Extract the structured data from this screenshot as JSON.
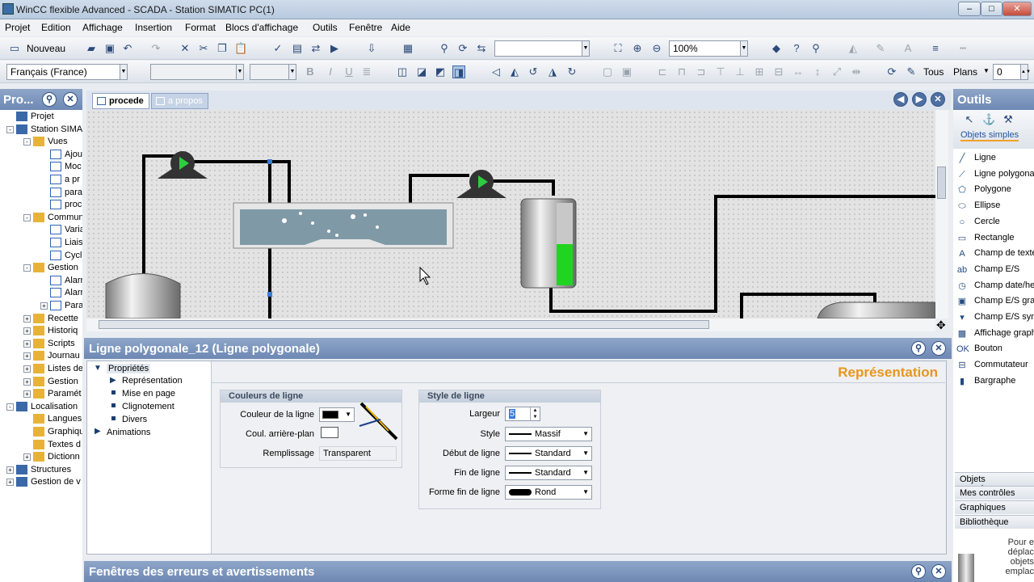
{
  "window": {
    "title": "WinCC flexible Advanced - SCADA - Station SIMATIC PC(1)"
  },
  "menu": [
    "Projet",
    "Edition",
    "Affichage",
    "Insertion",
    "Format",
    "Blocs d'affichage",
    "Outils",
    "Fenêtre",
    "Aide"
  ],
  "toolbar": {
    "new_label": "Nouveau",
    "zoom": "100%",
    "language": "Français (France)",
    "tous": "Tous",
    "plans": "Plans",
    "plans_value": "0"
  },
  "project_panel": {
    "title": "Pro...",
    "tree": [
      {
        "label": "Projet",
        "level": 0,
        "exp": ""
      },
      {
        "label": "Station SIMA",
        "level": 0,
        "exp": "-"
      },
      {
        "label": "Vues",
        "level": 1,
        "exp": "-"
      },
      {
        "label": "Ajou",
        "level": 2,
        "exp": ""
      },
      {
        "label": "Moc",
        "level": 2,
        "exp": ""
      },
      {
        "label": "a pr",
        "level": 2,
        "exp": ""
      },
      {
        "label": "para",
        "level": 2,
        "exp": ""
      },
      {
        "label": "proc",
        "level": 2,
        "exp": ""
      },
      {
        "label": "Commun",
        "level": 1,
        "exp": "-"
      },
      {
        "label": "Varia",
        "level": 2,
        "exp": ""
      },
      {
        "label": "Liais",
        "level": 2,
        "exp": ""
      },
      {
        "label": "Cycl",
        "level": 2,
        "exp": ""
      },
      {
        "label": "Gestion",
        "level": 1,
        "exp": "-"
      },
      {
        "label": "Alarr",
        "level": 2,
        "exp": ""
      },
      {
        "label": "Alarr",
        "level": 2,
        "exp": ""
      },
      {
        "label": "Para",
        "level": 2,
        "exp": "+"
      },
      {
        "label": "Recette",
        "level": 1,
        "exp": "+"
      },
      {
        "label": "Historiq",
        "level": 1,
        "exp": "+"
      },
      {
        "label": "Scripts",
        "level": 1,
        "exp": "+"
      },
      {
        "label": "Journau",
        "level": 1,
        "exp": "+"
      },
      {
        "label": "Listes de",
        "level": 1,
        "exp": "+"
      },
      {
        "label": "Gestion",
        "level": 1,
        "exp": "+"
      },
      {
        "label": "Paramét",
        "level": 1,
        "exp": "+"
      },
      {
        "label": "Localisation",
        "level": 0,
        "exp": "-"
      },
      {
        "label": "Langues",
        "level": 1,
        "exp": ""
      },
      {
        "label": "Graphiqu",
        "level": 1,
        "exp": ""
      },
      {
        "label": "Textes d",
        "level": 1,
        "exp": ""
      },
      {
        "label": "Dictionn",
        "level": 1,
        "exp": "+"
      },
      {
        "label": "Structures",
        "level": 0,
        "exp": "+"
      },
      {
        "label": "Gestion de v",
        "level": 0,
        "exp": "+"
      }
    ]
  },
  "tabs": [
    {
      "label": "procede",
      "active": true
    },
    {
      "label": "a propos",
      "active": false
    }
  ],
  "properties": {
    "header": "Ligne polygonale_12 (Ligne polygonale)",
    "nav": {
      "proprietes": "Propriétés",
      "representation": "Représentation",
      "mise_en_page": "Mise en page",
      "clignotement": "Clignotement",
      "divers": "Divers",
      "animations": "Animations"
    },
    "section_title": "Représentation",
    "line_colors": {
      "title": "Couleurs de ligne",
      "couleur_label": "Couleur de la ligne",
      "couleur_value": "#000000",
      "arriere_label": "Coul. arrière-plan",
      "arriere_value": "#ffffff",
      "remplissage_label": "Remplissage",
      "remplissage_value": "Transparent"
    },
    "line_style": {
      "title": "Style de ligne",
      "largeur_label": "Largeur",
      "largeur_value": "5",
      "style_label": "Style",
      "style_value": "Massif",
      "debut_label": "Début de ligne",
      "debut_value": "Standard",
      "fin_label": "Fin de ligne",
      "fin_value": "Standard",
      "forme_label": "Forme fin de ligne",
      "forme_value": "Rond"
    }
  },
  "errors_panel": {
    "title": "Fenêtres des erreurs et avertissements"
  },
  "tools_panel": {
    "title": "Outils",
    "tab": "Objets simples",
    "items": [
      {
        "label": "Ligne",
        "icon": "line-icon"
      },
      {
        "label": "Ligne polygonale",
        "icon": "polyline-icon"
      },
      {
        "label": "Polygone",
        "icon": "polygon-icon"
      },
      {
        "label": "Ellipse",
        "icon": "ellipse-icon"
      },
      {
        "label": "Cercle",
        "icon": "circle-icon"
      },
      {
        "label": "Rectangle",
        "icon": "rectangle-icon"
      },
      {
        "label": "Champ de texte",
        "icon": "text-icon"
      },
      {
        "label": "Champ E/S",
        "icon": "io-field-icon"
      },
      {
        "label": "Champ date/heure",
        "icon": "datetime-icon"
      },
      {
        "label": "Champ E/S graphique",
        "icon": "graphic-io-icon"
      },
      {
        "label": "Champ E/S symbolique",
        "icon": "symbolic-io-icon"
      },
      {
        "label": "Affichage graphique",
        "icon": "graphic-view-icon"
      },
      {
        "label": "Bouton",
        "icon": "button-icon"
      },
      {
        "label": "Commutateur",
        "icon": "switch-icon"
      },
      {
        "label": "Bargraphe",
        "icon": "bargraph-icon"
      }
    ],
    "categories": [
      "Objets complexes",
      "Mes contrôles",
      "Graphiques",
      "Bibliothèque"
    ],
    "hint": "Pour e déplac objets emplac"
  }
}
